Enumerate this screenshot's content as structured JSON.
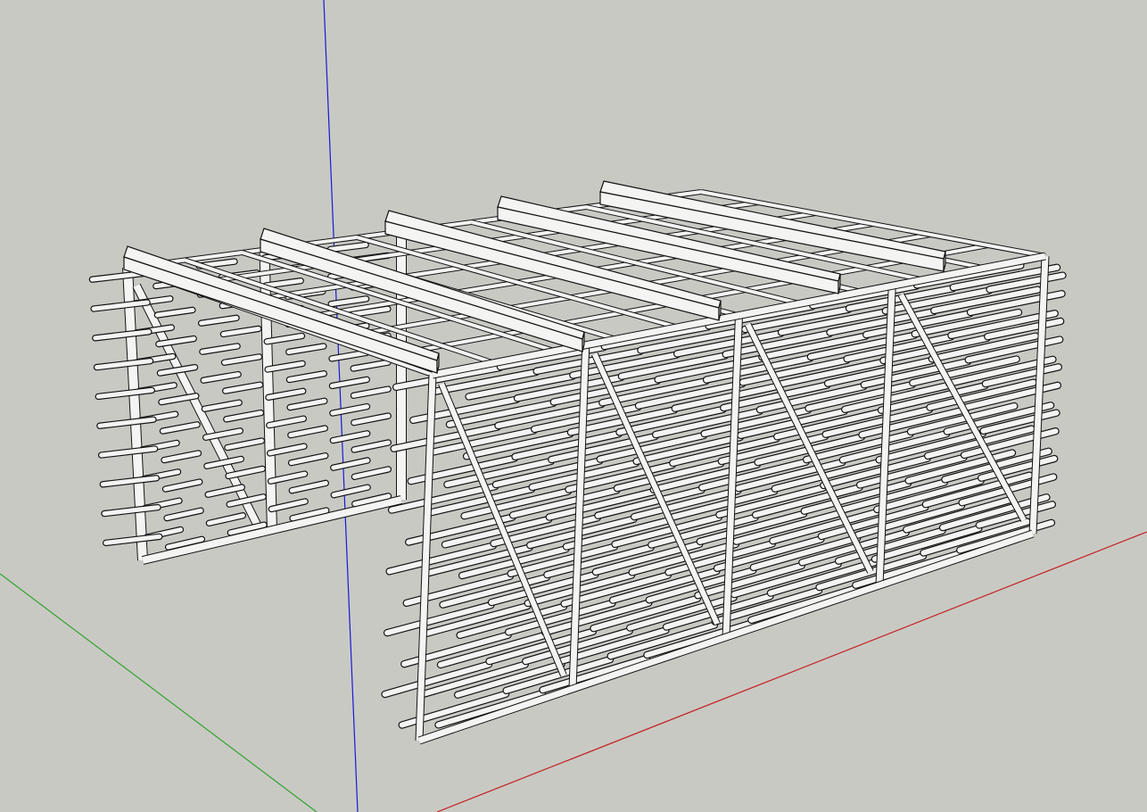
{
  "viewport": {
    "background": "#c9c9c4",
    "axes": {
      "blue": "#1a1ad6",
      "red": "#c41f1f",
      "green": "#2fa52f"
    },
    "model": {
      "fill": "#f4f4f2",
      "shade": "#d2d2cf",
      "edge": "#141414",
      "description_visible": false
    }
  }
}
